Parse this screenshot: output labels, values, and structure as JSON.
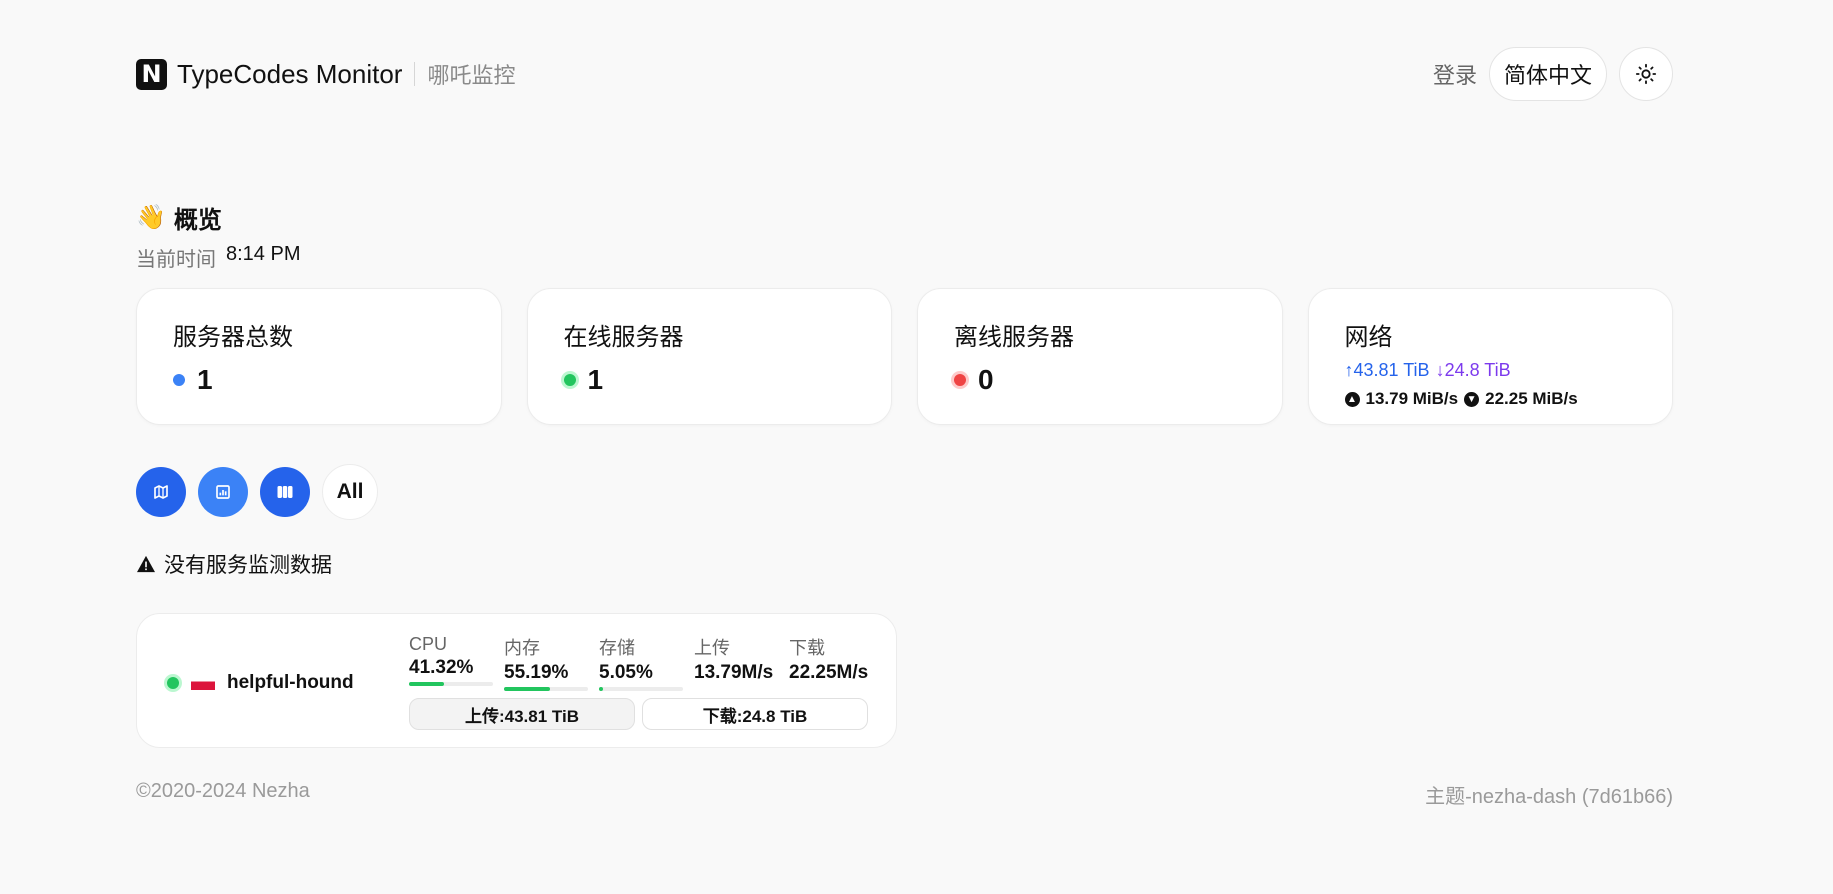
{
  "header": {
    "logo_letter": "N",
    "title": "TypeCodes Monitor",
    "subtitle": "哪吒监控",
    "login_label": "登录",
    "language_label": "简体中文",
    "theme_icon": "sun-icon"
  },
  "overview": {
    "emoji": "👋",
    "title": "概览",
    "time_label": "当前时间",
    "time_value": "8:14 PM"
  },
  "cards": {
    "total": {
      "title": "服务器总数",
      "count": "1",
      "color": "#3b82f6"
    },
    "online": {
      "title": "在线服务器",
      "count": "1",
      "color": "#22c55e"
    },
    "offline": {
      "title": "离线服务器",
      "count": "0",
      "color": "#ef4444"
    },
    "network": {
      "title": "网络",
      "up_total": "↑43.81 TiB",
      "down_total": "↓24.8 TiB",
      "up_speed": "13.79 MiB/s",
      "down_speed": "22.25 MiB/s"
    }
  },
  "filters": {
    "buttons": [
      {
        "icon": "map-icon"
      },
      {
        "icon": "chart-icon"
      },
      {
        "icon": "columns-icon"
      }
    ],
    "all_label": "All"
  },
  "warning": {
    "icon": "warning-icon",
    "text": "没有服务监测数据"
  },
  "server": {
    "status_color": "#22c55e",
    "flag": "Poland",
    "name": "helpful-hound",
    "metrics": {
      "cpu": {
        "label": "CPU",
        "value": "41.32%",
        "percent": 41.32
      },
      "memory": {
        "label": "内存",
        "value": "55.19%",
        "percent": 55.19
      },
      "storage": {
        "label": "存储",
        "value": "5.05%",
        "percent": 5.05
      },
      "upload": {
        "label": "上传",
        "value": "13.79M/s"
      },
      "download": {
        "label": "下载",
        "value": "22.25M/s"
      }
    },
    "upload_total": "上传:43.81 TiB",
    "download_total": "下载:24.8 TiB"
  },
  "footer": {
    "copyright": "©2020-2024 Nezha",
    "theme": "主题-nezha-dash (7d61b66)"
  }
}
